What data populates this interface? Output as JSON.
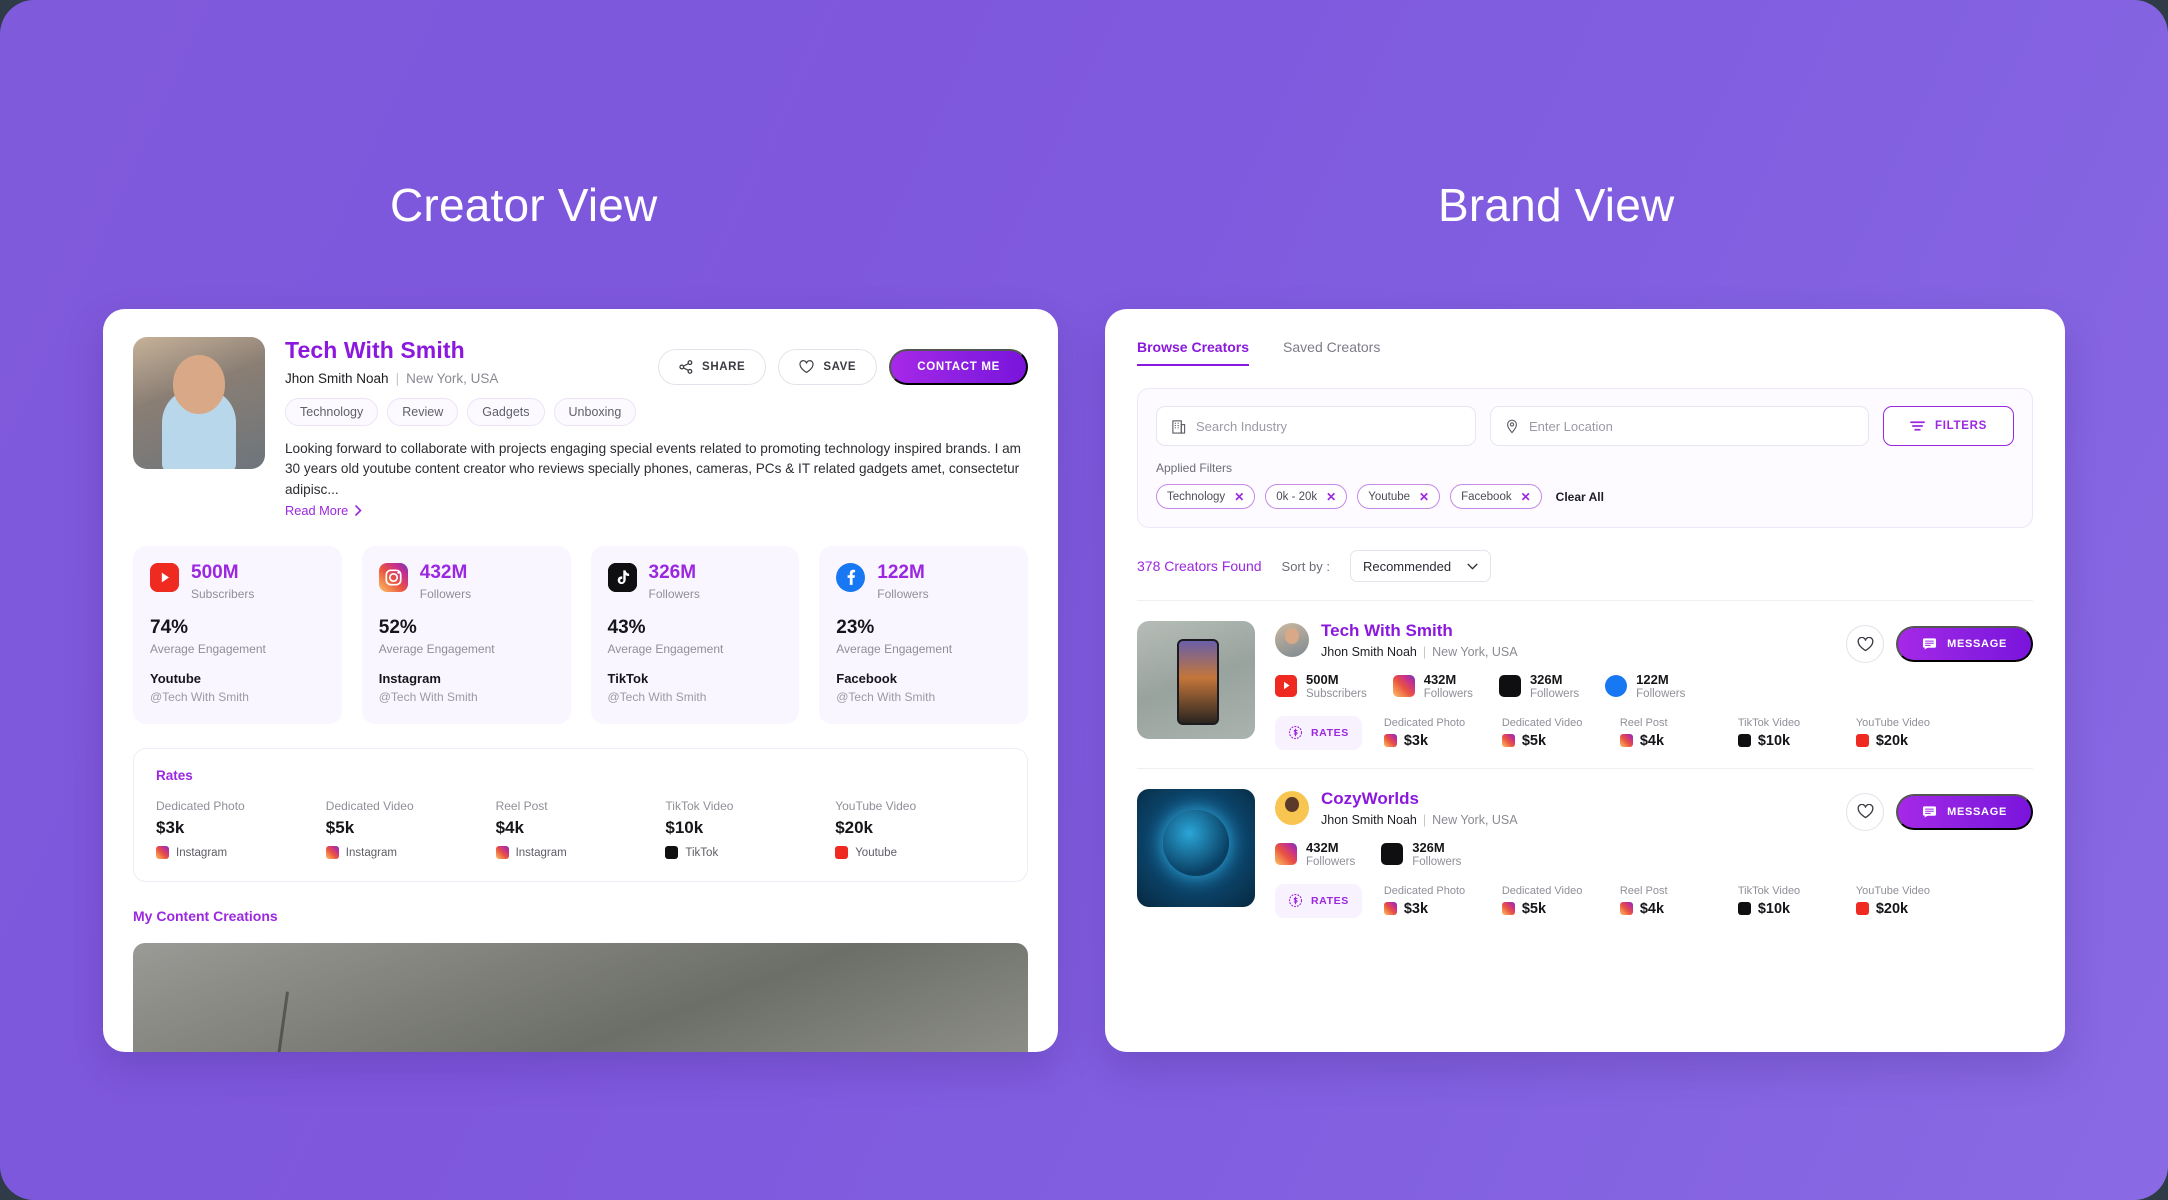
{
  "titles": {
    "creator": "Creator View",
    "brand": "Brand View"
  },
  "creator": {
    "name": "Tech With Smith",
    "real_name": "Jhon Smith Noah",
    "location": "New York, USA",
    "tags": [
      "Technology",
      "Review",
      "Gadgets",
      "Unboxing"
    ],
    "bio": "Looking forward to collaborate with projects engaging special events related to promoting technology inspired brands. I am 30 years old youtube content creator who reviews specially phones, cameras, PCs & IT related gadgets amet, consectetur adipisc...",
    "read_more": "Read More",
    "actions": {
      "share": "SHARE",
      "save": "SAVE",
      "contact": "CONTACT ME"
    },
    "stats": [
      {
        "icon": "youtube-icon",
        "value": "500M",
        "value_label": "Subscribers",
        "pct": "74%",
        "pct_label": "Average Engagement",
        "platform": "Youtube",
        "handle": "@Tech With Smith"
      },
      {
        "icon": "instagram-icon",
        "value": "432M",
        "value_label": "Followers",
        "pct": "52%",
        "pct_label": "Average Engagement",
        "platform": "Instagram",
        "handle": "@Tech With Smith"
      },
      {
        "icon": "tiktok-icon",
        "value": "326M",
        "value_label": "Followers",
        "pct": "43%",
        "pct_label": "Average Engagement",
        "platform": "TikTok",
        "handle": "@Tech With Smith"
      },
      {
        "icon": "facebook-icon",
        "value": "122M",
        "value_label": "Followers",
        "pct": "23%",
        "pct_label": "Average Engagement",
        "platform": "Facebook",
        "handle": "@Tech With Smith"
      }
    ],
    "rates_title": "Rates",
    "rates": [
      {
        "label": "Dedicated Photo",
        "price": "$3k",
        "platform": "Instagram",
        "icon": "instagram-icon"
      },
      {
        "label": "Dedicated Video",
        "price": "$5k",
        "platform": "Instagram",
        "icon": "instagram-icon"
      },
      {
        "label": "Reel Post",
        "price": "$4k",
        "platform": "Instagram",
        "icon": "instagram-icon"
      },
      {
        "label": "TikTok Video",
        "price": "$10k",
        "platform": "TikTok",
        "icon": "tiktok-icon"
      },
      {
        "label": "YouTube Video",
        "price": "$20k",
        "platform": "Youtube",
        "icon": "youtube-icon"
      }
    ],
    "content_section_title": "My Content Creations"
  },
  "brand": {
    "tabs": [
      {
        "label": "Browse Creators",
        "active": true
      },
      {
        "label": "Saved Creators",
        "active": false
      }
    ],
    "search": {
      "industry_placeholder": "Search Industry",
      "location_placeholder": "Enter Location",
      "filters_button": "FILTERS",
      "applied_label": "Applied Filters",
      "applied": [
        "Technology",
        "0k - 20k",
        "Youtube",
        "Facebook"
      ],
      "clear_all": "Clear All"
    },
    "results": {
      "count_text": "378 Creators Found",
      "sort_label": "Sort by :",
      "sort_value": "Recommended"
    },
    "rate_columns": [
      "Dedicated Photo",
      "Dedicated Video",
      "Reel Post",
      "TikTok Video",
      "YouTube Video"
    ],
    "rates_badge": "RATES",
    "message_label": "MESSAGE",
    "creators": [
      {
        "name": "Tech With Smith",
        "real_name": "Jhon Smith Noah",
        "location": "New York, USA",
        "thumb": "phone-in-hand-photo",
        "stats": [
          {
            "icon": "youtube-icon",
            "value": "500M",
            "label": "Subscribers"
          },
          {
            "icon": "instagram-icon",
            "value": "432M",
            "label": "Followers"
          },
          {
            "icon": "tiktok-icon",
            "value": "326M",
            "label": "Followers"
          },
          {
            "icon": "facebook-icon",
            "value": "122M",
            "label": "Followers"
          }
        ],
        "rates": [
          {
            "price": "$3k",
            "icon": "instagram-icon"
          },
          {
            "price": "$5k",
            "icon": "instagram-icon"
          },
          {
            "price": "$4k",
            "icon": "instagram-icon"
          },
          {
            "price": "$10k",
            "icon": "tiktok-icon"
          },
          {
            "price": "$20k",
            "icon": "youtube-icon"
          }
        ]
      },
      {
        "name": "CozyWorlds",
        "real_name": "Jhon Smith Noah",
        "location": "New York, USA",
        "thumb": "digital-globe-photo",
        "stats": [
          {
            "icon": "instagram-icon",
            "value": "432M",
            "label": "Followers"
          },
          {
            "icon": "tiktok-icon",
            "value": "326M",
            "label": "Followers"
          }
        ],
        "rates": [
          {
            "price": "$3k",
            "icon": "instagram-icon"
          },
          {
            "price": "$5k",
            "icon": "instagram-icon"
          },
          {
            "price": "$4k",
            "icon": "instagram-icon"
          },
          {
            "price": "$10k",
            "icon": "tiktok-icon"
          },
          {
            "price": "$20k",
            "icon": "youtube-icon"
          }
        ]
      }
    ]
  },
  "colors": {
    "accent": "#8b19dd",
    "accent_light": "#9b27e0",
    "background": "#7e57dd"
  }
}
